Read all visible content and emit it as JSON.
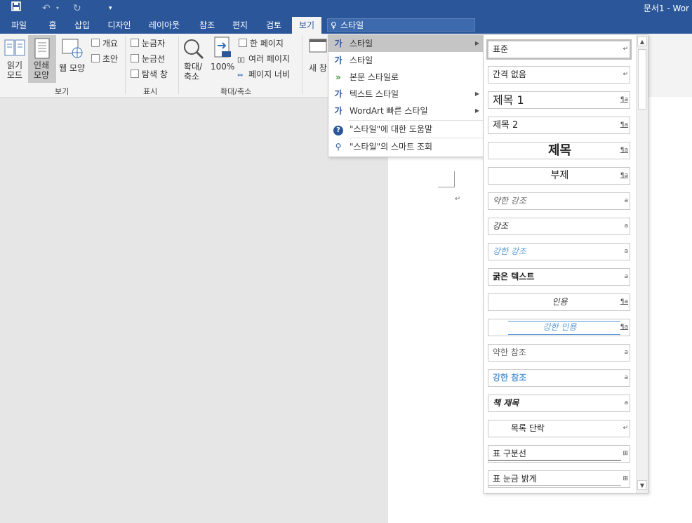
{
  "titlebar": {
    "save_icon": "save-icon",
    "undo_icon": "undo-icon",
    "redo_icon": "redo-icon",
    "customize_icon": "customize-qat-icon",
    "document_title": "문서1 - Wor"
  },
  "tabs": [
    "파일",
    "홈",
    "삽입",
    "디자인",
    "레이아웃",
    "참조",
    "편지",
    "검토",
    "보기"
  ],
  "active_tab": "보기",
  "search": {
    "value": "스타일",
    "icon": "lightbulb-icon"
  },
  "ribbon": {
    "views": {
      "read_mode": "읽기\n모드",
      "print_layout": "인쇄\n모양",
      "web_layout": "웹 모양",
      "outline": "개요",
      "draft": "초안",
      "group": "보기"
    },
    "show": {
      "ruler": "눈금자",
      "gridlines": "눈금선",
      "nav_pane": "탐색 창",
      "group": "표시"
    },
    "zoom": {
      "zoom": "확대/\n축소",
      "hundred": "100%",
      "one_page": "한 페이지",
      "multiple_pages": "여러 페이지",
      "page_width": "페이지 너비",
      "group": "확대/축소"
    },
    "window": {
      "new_window": "새 창"
    }
  },
  "menu": {
    "items": [
      {
        "label": "스타일",
        "icon": "styles-icon",
        "submenu": true,
        "highlighted": true
      },
      {
        "label": "스타일",
        "icon": "styles-icon",
        "submenu": false
      },
      {
        "label": "본문 스타일로",
        "icon": "arrow-right-icon",
        "submenu": false
      },
      {
        "label": "텍스트 스타일",
        "icon": "text-styles-icon",
        "submenu": true
      },
      {
        "label": "WordArt 빠른 스타일",
        "icon": "wordart-icon",
        "submenu": true
      },
      {
        "label": "\"스타일\"에 대한 도움말",
        "icon": "help-icon",
        "submenu": false
      },
      {
        "label": "\"스타일\"의 스마트 조회",
        "icon": "smart-lookup-icon",
        "submenu": false
      }
    ]
  },
  "styles": [
    {
      "name": "표준",
      "mark": "↵"
    },
    {
      "name": "간격 없음",
      "mark": "↵"
    },
    {
      "name": "제목 1",
      "mark": "¶a"
    },
    {
      "name": "제목 2",
      "mark": "¶a"
    },
    {
      "name": "제목",
      "mark": "¶a"
    },
    {
      "name": "부제",
      "mark": "¶a"
    },
    {
      "name": "약한 강조",
      "mark": "a"
    },
    {
      "name": "강조",
      "mark": "a"
    },
    {
      "name": "강한 강조",
      "mark": "a"
    },
    {
      "name": "굵은 텍스트",
      "mark": "a"
    },
    {
      "name": "인용",
      "mark": "¶a"
    },
    {
      "name": "강한 인용",
      "mark": "¶a"
    },
    {
      "name": "약한 참조",
      "mark": "a"
    },
    {
      "name": "강한 참조",
      "mark": "a"
    },
    {
      "name": "책 제목",
      "mark": "a"
    },
    {
      "name": "목록 단락",
      "mark": "↵"
    },
    {
      "name": "표 구분선",
      "mark": "⊞"
    },
    {
      "name": "표 눈금 밝게",
      "mark": "⊞"
    }
  ],
  "document": {
    "paragraph_mark": "↵"
  },
  "colors": {
    "brand": "#2b579a",
    "accent_blue": "#5b9bd5",
    "menu_highlight": "#c5c5c5"
  }
}
